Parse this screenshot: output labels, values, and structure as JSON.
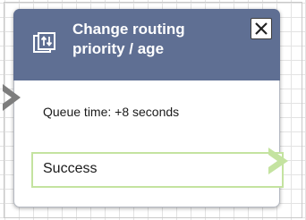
{
  "block": {
    "title": "Change routing\npriority / age",
    "icon": "routing-priority-icon",
    "close_icon": "close-icon",
    "header_color": "#5f6f93",
    "parameter_text": "Queue time: +8 seconds",
    "input_connector_icon": "chevron-right-icon",
    "branches": [
      {
        "label": "Success",
        "color": "#c4e3a0",
        "connector_icon": "arrow-right-icon"
      }
    ]
  }
}
